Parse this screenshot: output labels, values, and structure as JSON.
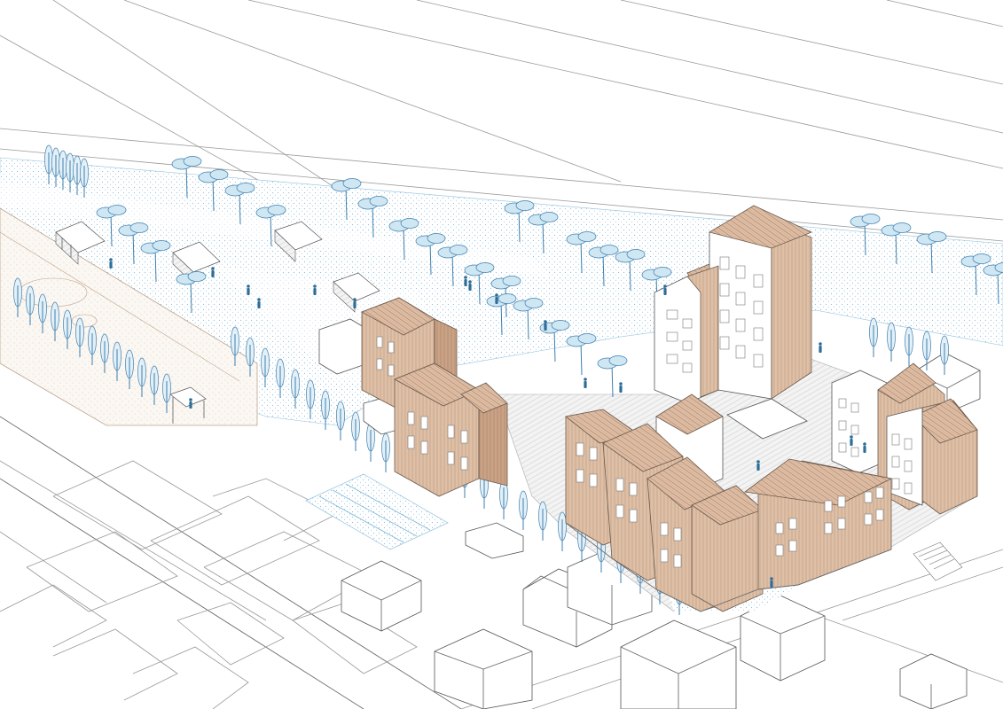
{
  "scene": {
    "type": "isometric architectural site drawing",
    "palette": {
      "background": "#ffffff",
      "vegetation_blue": "#3d7fae",
      "stipple_blue": "#7fb6d6",
      "timber": "#d9b8a0",
      "linework": "#555555"
    }
  }
}
